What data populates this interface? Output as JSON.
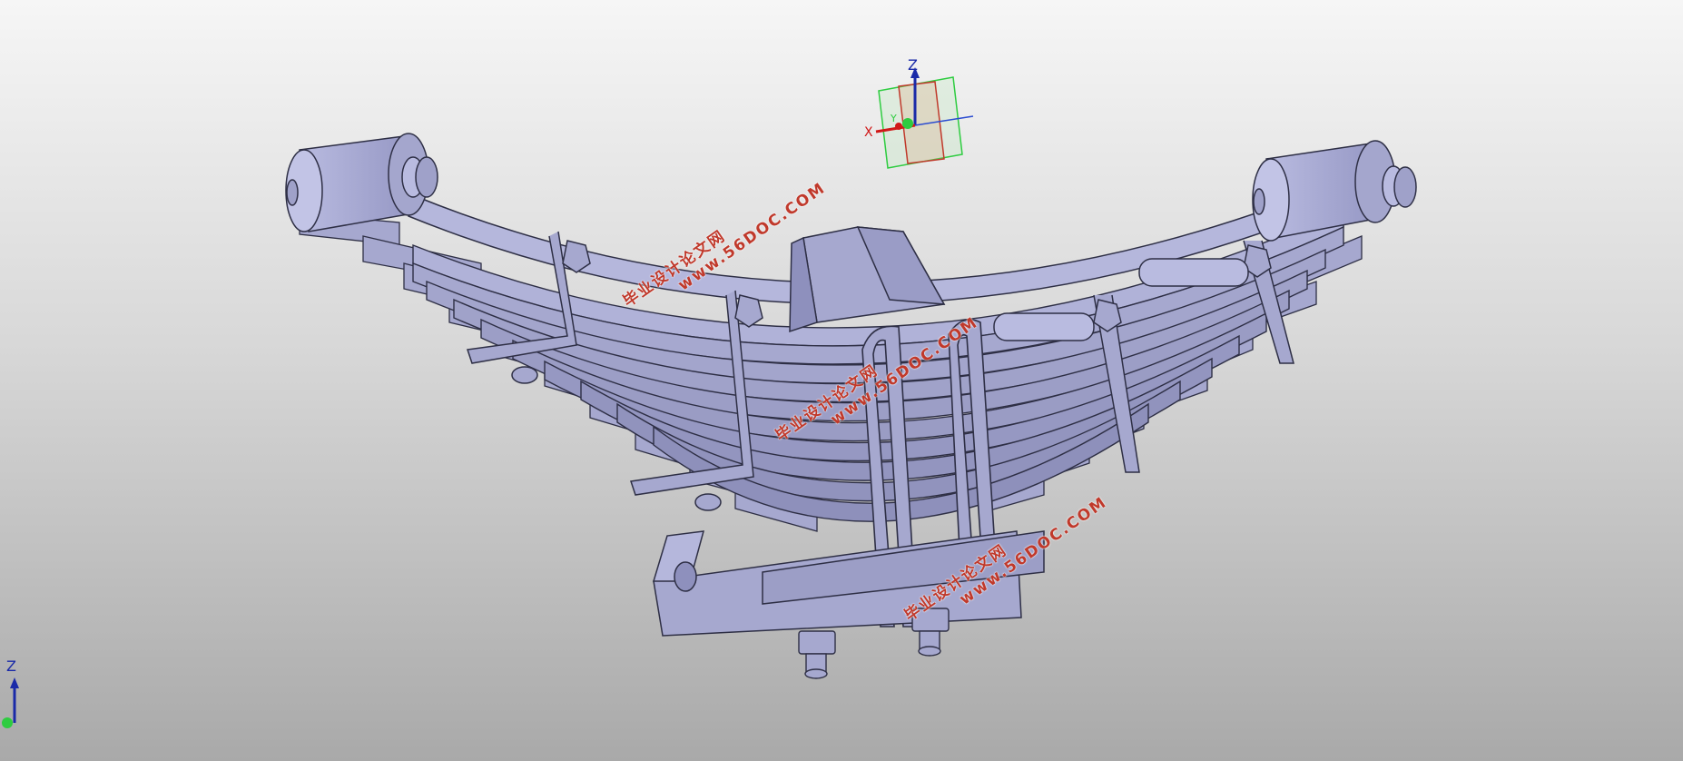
{
  "viewport": {
    "background_top": "#f6f6f6",
    "background_bottom": "#a9a9a9",
    "model_color": "#a6a8cf",
    "model_shade": "#8e90bd",
    "model_edge": "#2e2f45"
  },
  "triad_main": {
    "z_label": "Z",
    "x_label": "X",
    "y_label": "Y"
  },
  "triad_corner": {
    "z_label": "Z"
  },
  "watermarks": [
    {
      "cn": "毕业设计论文网",
      "url": "www.56DOC.COM"
    },
    {
      "cn": "毕业设计论文网",
      "url": "www.56DOC.COM"
    },
    {
      "cn": "毕业设计论文网",
      "url": "www.56DOC.COM"
    }
  ]
}
